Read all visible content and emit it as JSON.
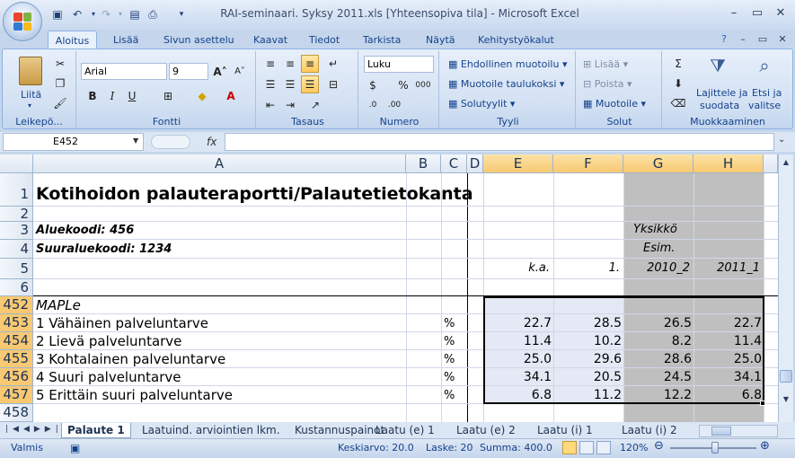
{
  "window": {
    "title": "RAI-seminaari. Syksy 2011.xls  [Yhteensopiva tila] - Microsoft Excel"
  },
  "ribbon_tabs": [
    "Aloitus",
    "Lisää",
    "Sivun asettelu",
    "Kaavat",
    "Tiedot",
    "Tarkista",
    "Näytä",
    "Kehitystyökalut"
  ],
  "ribbon": {
    "clipboard": {
      "paste": "Liitä",
      "label": "Leikepö..."
    },
    "font": {
      "name": "Arial",
      "size": "9",
      "label": "Fontti",
      "bold": "B",
      "italic": "I",
      "underline": "U",
      "grow": "A",
      "shrink": "A"
    },
    "alignment": {
      "label": "Tasaus"
    },
    "number": {
      "format": "Luku",
      "label": "Numero",
      "percent": "%",
      "thousands": "000"
    },
    "styles": {
      "conditional": "Ehdollinen muotoilu",
      "as_table": "Muotoile taulukoksi",
      "cell_styles": "Solutyylit",
      "label": "Tyyli"
    },
    "cells": {
      "insert": "Lisää",
      "delete": "Poista",
      "format": "Muotoile",
      "label": "Solut"
    },
    "editing": {
      "sum": "Σ",
      "sort_filter_1": "Lajittele ja",
      "sort_filter_2": "suodata",
      "find_1": "Etsi ja",
      "find_2": "valitse",
      "label": "Muokkaaminen"
    }
  },
  "formula_bar": {
    "name_box": "E452",
    "fx": "fx",
    "formula": ""
  },
  "columns": [
    "A",
    "B",
    "C",
    "D",
    "E",
    "F",
    "G",
    "H"
  ],
  "rows_visible": [
    "1",
    "2",
    "3",
    "4",
    "5",
    "6",
    "452",
    "453",
    "454",
    "455",
    "456",
    "457",
    "458"
  ],
  "sheet": {
    "title": "Kotihoidon palauteraportti/Palautetietokanta",
    "region_code": "Aluekoodi: 456",
    "super_region_code": "Suuraluekoodi: 1234",
    "unit_label": "Yksikkö",
    "example_label": "Esim.",
    "col_headers_row5": {
      "E": "k.a.",
      "F": "1.",
      "G": "2010_2",
      "H": "2011_1"
    },
    "section_label": "MAPLe",
    "data_rows": [
      {
        "label": " 1  Vähäinen palveluntarve",
        "unit": "%",
        "E": "22.7",
        "F": "28.5",
        "G": "26.5",
        "H": "22.7"
      },
      {
        "label": " 2  Lievä palveluntarve",
        "unit": "%",
        "E": "11.4",
        "F": "10.2",
        "G": "8.2",
        "H": "11.4"
      },
      {
        "label": " 3  Kohtalainen palveluntarve",
        "unit": "%",
        "E": "25.0",
        "F": "29.6",
        "G": "28.6",
        "H": "25.0"
      },
      {
        "label": " 4  Suuri palveluntarve",
        "unit": "%",
        "E": "34.1",
        "F": "20.5",
        "G": "24.5",
        "H": "34.1"
      },
      {
        "label": " 5  Erittäin suuri palveluntarve",
        "unit": "%",
        "E": "6.8",
        "F": "11.2",
        "G": "12.2",
        "H": "6.8"
      }
    ]
  },
  "sheet_tabs": [
    "Palaute 1",
    "Laatuind. arviointien lkm.",
    "Kustannuspainot",
    "Laatu (e) 1",
    "Laatu (e) 2",
    "Laatu (i) 1",
    "Laatu (i) 2"
  ],
  "status_bar": {
    "mode": "Valmis",
    "average": "Keskiarvo: 20.0",
    "count": "Laske: 20",
    "sum": "Summa: 400.0",
    "zoom": "120%"
  },
  "colors": {
    "selection_fill": "#e4e9f5",
    "grey_fill": "#bfbfbf",
    "header_selected": "#f8c872"
  }
}
